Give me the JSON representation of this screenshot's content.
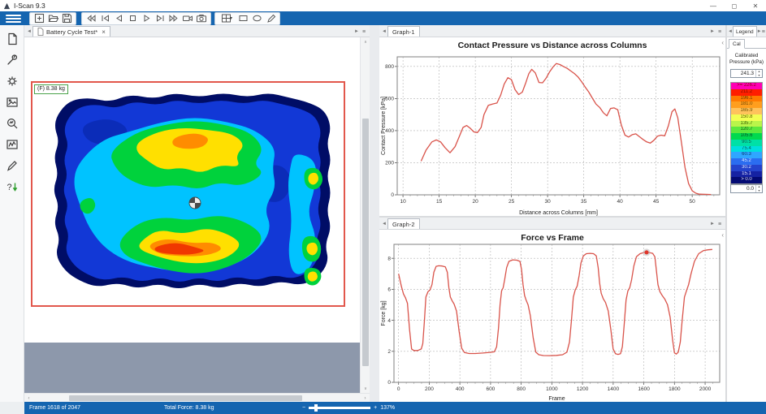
{
  "window": {
    "title": "I-Scan 9.3",
    "minimize": "—",
    "maximize": "◻",
    "close": "✕"
  },
  "glyphs": {
    "nav_left": "◄",
    "nav_right": "►",
    "menu": "≡",
    "collapse_left": "‹",
    "scroll_up": "∧",
    "scroll_down": "∨",
    "scroll_left": "‹",
    "scroll_right": "›",
    "spin_up": "▲",
    "spin_down": "▼",
    "caret_down": "▾",
    "close": "×"
  },
  "toolbar": {
    "icons": [
      "menu",
      "new-window",
      "open-file",
      "save-file",
      "rewind",
      "first-frame",
      "previous-frame",
      "stop",
      "play",
      "next-frame",
      "fast-forward",
      "record-movie",
      "snapshot",
      "grid-layout",
      "rectangle-tool",
      "ellipse-tool",
      "pencil-tool"
    ]
  },
  "sidebar": {
    "icons": [
      "document",
      "wrench",
      "settings-gear",
      "image",
      "zoom-analysis",
      "graph-window",
      "pencil",
      "help-download"
    ]
  },
  "main_view": {
    "tab_label": "Battery Cycle Test*",
    "force_label": "(F) 8.38 kg"
  },
  "graph1": {
    "tab_label": "Graph-1"
  },
  "graph2": {
    "tab_label": "Graph-2"
  },
  "legend": {
    "tab_label": "Legend",
    "cal_tab": "Cal",
    "title_line1": "Calibrated",
    "title_line2": "Pressure (kPa)",
    "max_value": "241.3",
    "min_value": "0.0",
    "scale": [
      {
        "label": ">= 226.2",
        "color": "#ff00b4",
        "text_color": "#8c0010"
      },
      {
        "label": "211.2",
        "color": "#ff1e00",
        "text_color": "#801000"
      },
      {
        "label": "196.1",
        "color": "#ff7a00",
        "text_color": "#6e3a00"
      },
      {
        "label": "181.0",
        "color": "#ff9e1e",
        "text_color": "#6e4300"
      },
      {
        "label": "165.9",
        "color": "#ffc35c",
        "text_color": "#6e4f00"
      },
      {
        "label": "150.8",
        "color": "#f2ff54",
        "text_color": "#5c5c00"
      },
      {
        "label": "135.7",
        "color": "#baf54a",
        "text_color": "#3d5c00"
      },
      {
        "label": "120.7",
        "color": "#5ce83e",
        "text_color": "#1d5c13"
      },
      {
        "label": "105.6",
        "color": "#00d94f",
        "text_color": "#0b4d26"
      },
      {
        "label": "90.5",
        "color": "#00e0a6",
        "text_color": "#0b5c4a"
      },
      {
        "label": "75.4",
        "color": "#00dede",
        "text_color": "#0b5c5c"
      },
      {
        "label": "60.3",
        "color": "#2fa6ff",
        "text_color": "#0b3c6e"
      },
      {
        "label": "45.2",
        "color": "#2b6df0",
        "text_color": "#dce8ff"
      },
      {
        "label": "30.2",
        "color": "#2443cc",
        "text_color": "#dce8ff"
      },
      {
        "label": "15.1",
        "color": "#1522a3",
        "text_color": "#e8ecff"
      },
      {
        "label": "> 0.0",
        "color": "#030a73",
        "text_color": "#e8ecff"
      }
    ]
  },
  "status_bar": {
    "frame": "Frame 1618 of 2047",
    "total_force": "Total Force: 8.38 kg",
    "zoom_out": "−",
    "zoom_in": "+",
    "zoom_level": "137%"
  },
  "chart_data": [
    {
      "type": "line",
      "title": "Contact Pressure vs Distance across Columns",
      "xlabel": "Distance across Columns [mm]",
      "ylabel": "Contact Pressure [kPa]",
      "xlim": [
        9.2,
        53.8
      ],
      "ylim": [
        0,
        860
      ],
      "xticks": [
        10,
        15,
        20,
        25,
        30,
        35,
        40,
        45,
        50
      ],
      "yticks": [
        0,
        200,
        400,
        600,
        800
      ],
      "minor_xtick": 1,
      "grid": true,
      "legend_position": "none",
      "line_color": "#d9534a",
      "x": [
        12.5,
        13.2,
        14,
        14.6,
        15.2,
        15.8,
        16.5,
        17.2,
        17.8,
        18.3,
        18.8,
        19.3,
        19.8,
        20.3,
        20.8,
        21.2,
        21.8,
        22.4,
        23,
        23.5,
        24,
        24.5,
        25,
        25.5,
        26,
        26.5,
        27,
        27.4,
        27.8,
        28.3,
        28.8,
        29.3,
        29.8,
        30.3,
        30.8,
        31.2,
        31.7,
        32.2,
        32.7,
        33.2,
        33.7,
        34.2,
        34.7,
        35.2,
        35.7,
        36.2,
        36.7,
        37.2,
        37.7,
        38.2,
        38.7,
        39.2,
        39.7,
        40.2,
        40.7,
        41.2,
        41.7,
        42.2,
        42.7,
        43.2,
        43.7,
        44.2,
        44.7,
        45.2,
        45.7,
        46.2,
        46.7,
        47.2,
        47.6,
        48,
        48.5,
        49,
        49.5,
        50,
        50.5,
        51,
        51.8,
        52.6
      ],
      "y": [
        210,
        280,
        330,
        342,
        330,
        295,
        262,
        300,
        365,
        420,
        432,
        415,
        392,
        388,
        420,
        500,
        558,
        566,
        572,
        620,
        690,
        730,
        718,
        655,
        625,
        640,
        700,
        755,
        782,
        760,
        700,
        698,
        728,
        768,
        800,
        818,
        812,
        800,
        788,
        772,
        756,
        735,
        705,
        672,
        640,
        602,
        565,
        545,
        512,
        492,
        538,
        542,
        530,
        435,
        372,
        360,
        375,
        380,
        362,
        345,
        330,
        322,
        340,
        366,
        372,
        368,
        430,
        518,
        535,
        480,
        330,
        170,
        70,
        25,
        10,
        4,
        3,
        2
      ]
    },
    {
      "type": "line",
      "title": "Force vs Frame",
      "xlabel": "Frame",
      "ylabel": "Force [kg]",
      "xlim": [
        -30,
        2095
      ],
      "ylim": [
        0,
        8.9
      ],
      "xticks": [
        0,
        200,
        400,
        600,
        800,
        1000,
        1200,
        1400,
        1600,
        1800,
        2000
      ],
      "yticks": [
        0,
        2,
        4,
        6,
        8
      ],
      "minor_xtick": 50,
      "grid": true,
      "legend_position": "none",
      "line_color": "#d9534a",
      "marker": {
        "x": 1618,
        "y": 8.38
      },
      "x": [
        0,
        18,
        32,
        45,
        58,
        72,
        85,
        100,
        125,
        148,
        158,
        168,
        178,
        192,
        205,
        218,
        230,
        245,
        262,
        285,
        305,
        318,
        328,
        338,
        350,
        362,
        378,
        395,
        412,
        430,
        460,
        500,
        550,
        595,
        625,
        640,
        652,
        662,
        672,
        682,
        692,
        705,
        720,
        745,
        772,
        792,
        802,
        812,
        822,
        832,
        845,
        860,
        878,
        895,
        915,
        945,
        985,
        1030,
        1070,
        1098,
        1115,
        1128,
        1140,
        1152,
        1165,
        1178,
        1190,
        1205,
        1225,
        1250,
        1272,
        1290,
        1302,
        1312,
        1322,
        1335,
        1350,
        1368,
        1385,
        1400,
        1415,
        1432,
        1448,
        1460,
        1472,
        1484,
        1496,
        1508,
        1520,
        1535,
        1552,
        1575,
        1600,
        1618,
        1638,
        1658,
        1672,
        1682,
        1692,
        1705,
        1720,
        1738,
        1755,
        1772,
        1788,
        1800,
        1812,
        1825,
        1838,
        1850,
        1865,
        1880,
        1892,
        1908,
        1930,
        1958,
        1990,
        2020,
        2047
      ],
      "y": [
        7,
        6.2,
        5.7,
        5.45,
        5.1,
        3.4,
        2.15,
        2.05,
        2.05,
        2.15,
        2.5,
        3.9,
        5.5,
        5.85,
        5.95,
        6.3,
        7.1,
        7.48,
        7.52,
        7.5,
        7.45,
        7.1,
        6.1,
        5.5,
        5.25,
        5.05,
        4.6,
        3.3,
        2.2,
        1.92,
        1.86,
        1.86,
        1.89,
        1.93,
        1.97,
        2.3,
        3.5,
        5,
        5.9,
        6.1,
        6.6,
        7.4,
        7.8,
        7.9,
        7.88,
        7.8,
        7.3,
        6.3,
        5.6,
        5.3,
        5,
        4.3,
        2.9,
        1.95,
        1.78,
        1.73,
        1.72,
        1.74,
        1.78,
        1.95,
        2.6,
        4,
        5.5,
        5.95,
        6.2,
        6.9,
        7.7,
        8.15,
        8.3,
        8.32,
        8.3,
        8.15,
        7.4,
        6.4,
        5.75,
        5.4,
        5.15,
        4.6,
        3.4,
        2.15,
        1.85,
        1.8,
        1.85,
        2.3,
        3.7,
        5.3,
        5.9,
        6.1,
        6.6,
        7.5,
        8.1,
        8.3,
        8.37,
        8.38,
        8.36,
        8.32,
        8.1,
        7.2,
        6.3,
        5.85,
        5.6,
        5.35,
        5,
        4.2,
        2.7,
        1.9,
        1.82,
        1.95,
        2.6,
        4,
        5.5,
        5.95,
        6.3,
        7,
        7.8,
        8.3,
        8.5,
        8.55,
        8.57
      ]
    }
  ]
}
